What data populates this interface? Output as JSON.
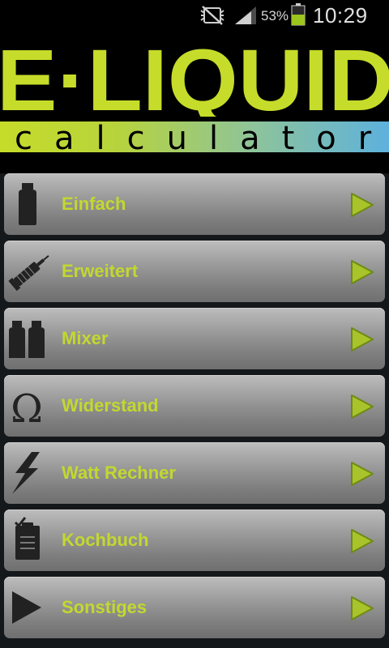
{
  "status_bar": {
    "battery_percent": "53%",
    "battery_level": 0.53,
    "time": "10:29",
    "icons": [
      "mute-icon",
      "signal-icon",
      "battery-icon"
    ]
  },
  "header": {
    "logo_title": "E·LIQUID",
    "logo_subtitle": "calculator"
  },
  "colors": {
    "label": "#c3d82f",
    "arrow": "#a8c42a",
    "background": "#15181b"
  },
  "menu": {
    "items": [
      {
        "label": "Einfach",
        "icon": "bottle-icon"
      },
      {
        "label": "Erweitert",
        "icon": "syringe-icon"
      },
      {
        "label": "Mixer",
        "icon": "double-bottle-icon"
      },
      {
        "label": "Widerstand",
        "icon": "omega-icon"
      },
      {
        "label": "Watt Rechner",
        "icon": "lightning-icon"
      },
      {
        "label": "Kochbuch",
        "icon": "clipboard-icon"
      },
      {
        "label": "Sonstiges",
        "icon": "play-icon"
      }
    ]
  }
}
